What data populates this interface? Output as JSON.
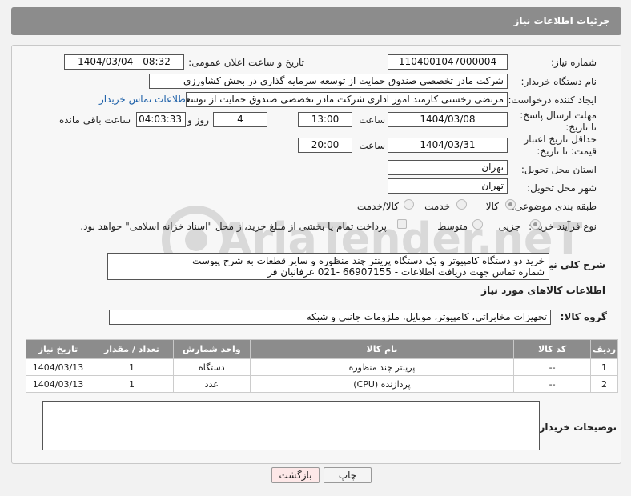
{
  "header": {
    "title": "جزئیات اطلاعات نیاز"
  },
  "fields": {
    "need_number_label": "شماره نیاز:",
    "need_number": "1104001047000004",
    "announce_label": "تاریخ و ساعت اعلان عمومی:",
    "announce_value": "1404/03/04 - 08:32",
    "buyer_label": "نام دستگاه خریدار:",
    "buyer_value": "شرکت مادر تخصصی صندوق حمایت از توسعه سرمایه گذاری در بخش کشاورزی",
    "creator_label": "ایجاد کننده درخواست:",
    "creator_value": "مرتضی رخستی کارمند امور اداری شرکت مادر تخصصی صندوق حمایت از توسعه",
    "contact_link": "اطلاعات تماس خریدار",
    "deadline_label": "مهلت ارسال پاسخ: تا تاریخ:",
    "deadline_date": "1404/03/08",
    "time_label": "ساعت",
    "deadline_time": "13:00",
    "days_value": "4",
    "days_label": "روز و",
    "remaining_time": "04:03:33",
    "remaining_label": "ساعت باقی مانده",
    "validity_label": "حداقل تاریخ اعتبار قیمت: تا تاریخ:",
    "validity_date": "1404/03/31",
    "validity_time": "20:00",
    "province_label": "استان محل تحویل:",
    "province_value": "تهران",
    "city_label": "شهر محل تحویل:",
    "city_value": "تهران",
    "category_label": "طبقه بندی موضوعی:",
    "category_options": [
      "کالا",
      "خدمت",
      "کالا/خدمت"
    ],
    "process_label": "نوع فرآیند خرید :",
    "process_options": [
      "جزیی",
      "متوسط"
    ],
    "payment_note": "پرداخت تمام یا بخشی از مبلغ خرید،از محل \"اسناد خزانه اسلامی\" خواهد بود.",
    "description_label": "شرح کلی نیاز:",
    "description_line1": "خرید دو دستگاه کامپیوتر و یک دستگاه پرینتر چند منظوره و سایر قطعات به شرح پیوست",
    "description_line2": "شماره تماس جهت دریافت اطلاعات - 66907155 -021  عرفانیان فر"
  },
  "goods": {
    "section_title": "اطلاعات کالاهای مورد نیاز",
    "group_label": "گروه کالا:",
    "group_value": "تجهیزات مخابراتی، کامپیوتر، موبایل، ملزومات جانبی و شبکه",
    "columns": [
      "ردیف",
      "کد کالا",
      "نام کالا",
      "واحد شمارش",
      "تعداد / مقدار",
      "تاریخ نیاز"
    ],
    "rows": [
      [
        "1",
        "--",
        "پرینتر چند منظوره",
        "دستگاه",
        "1",
        "1404/03/13"
      ],
      [
        "2",
        "--",
        "پردازنده (CPU)",
        "عدد",
        "1",
        "1404/03/13"
      ]
    ]
  },
  "buyer_notes_label": "توضیحات خریدار:",
  "buttons": {
    "print": "چاپ",
    "back": "بازگشت"
  },
  "watermark": "AriaTender.neT",
  "colors": {
    "header_bg": "#8c8c8c",
    "link": "#1b5fa8",
    "back_button_bg": "#fde8e8"
  }
}
